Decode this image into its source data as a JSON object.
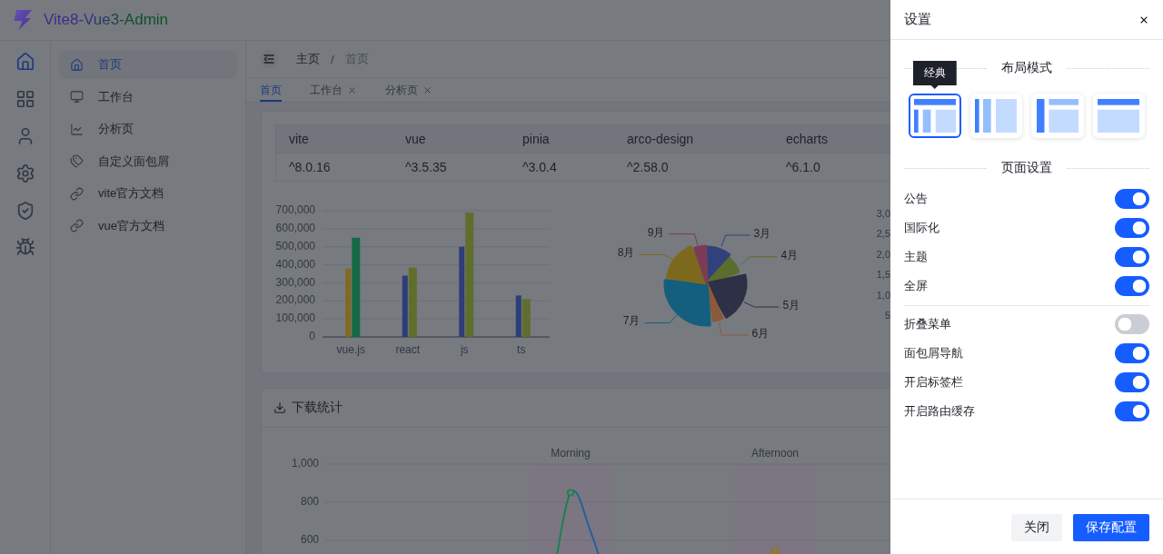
{
  "header": {
    "title": "Vite8-Vue3-Admin"
  },
  "icon_rail": [
    {
      "selected": true
    },
    {
      "selected": false
    },
    {
      "selected": false
    },
    {
      "selected": false
    },
    {
      "selected": false
    },
    {
      "selected": false
    }
  ],
  "menu": [
    {
      "label": "首页",
      "selected": true
    },
    {
      "label": "工作台",
      "selected": false
    },
    {
      "label": "分析页",
      "selected": false
    },
    {
      "label": "自定义面包屑",
      "selected": false
    },
    {
      "label": "vite官方文档",
      "selected": false
    },
    {
      "label": "vue官方文档",
      "selected": false
    }
  ],
  "breadcrumb": {
    "items": [
      "主页",
      "首页"
    ],
    "separator": "/"
  },
  "tabs": [
    {
      "label": "首页",
      "selected": true,
      "closable": false
    },
    {
      "label": "工作台",
      "selected": false,
      "closable": true
    },
    {
      "label": "分析页",
      "selected": false,
      "closable": true
    }
  ],
  "version_table": {
    "columns": [
      "vite",
      "vue",
      "pinia",
      "arco-design",
      "echarts"
    ],
    "rows": [
      [
        "^8.0.16",
        "^3.5.35",
        "^3.0.4",
        "^2.58.0",
        "^6.1.0"
      ]
    ]
  },
  "bar_chart": {
    "chart_data": {
      "type": "bar",
      "grid": true,
      "categories": [
        "vue.js",
        "react",
        "js",
        "ts"
      ],
      "series": [
        {
          "colors": [
            "#83691e",
            "#2e3d78",
            "#2e3d78",
            "#2e3d78"
          ],
          "values": [
            380000,
            340000,
            500000,
            230000
          ]
        },
        {
          "colors": [
            "#146a46",
            "#5f6e2d",
            "#5f6e2d",
            "#5f6e2d"
          ],
          "values": [
            550000,
            385000,
            690000,
            210000
          ]
        }
      ],
      "ylim": [
        0,
        700000
      ],
      "yticks": [
        {
          "value": 0,
          "label": "0"
        },
        {
          "value": 100000,
          "label": "100,000"
        },
        {
          "value": 200000,
          "label": "200,000"
        },
        {
          "value": 300000,
          "label": "300,000"
        },
        {
          "value": 400000,
          "label": "400,000"
        },
        {
          "value": 500000,
          "label": "500,000"
        },
        {
          "value": 600000,
          "label": "600,000"
        },
        {
          "value": 700000,
          "label": "700,000"
        }
      ]
    }
  },
  "rose_chart": {
    "slices": [
      {
        "label": "3月",
        "color": "#32417d"
      },
      {
        "label": "4月",
        "color": "#5a6e2d"
      },
      {
        "label": "5月",
        "color": "#2d3046"
      },
      {
        "label": "6月",
        "color": "#8a5a3a"
      },
      {
        "label": "7月",
        "color": "#145f7d"
      },
      {
        "label": "8月",
        "color": "#7d691e"
      },
      {
        "label": "9月",
        "color": "#7d3c55"
      }
    ]
  },
  "partial_chart": {
    "ytick_labels": [
      "3,0",
      "2,5",
      "2,0",
      "1,5",
      "1,0",
      "5"
    ]
  },
  "download_card": {
    "title": "下载统计",
    "chart": {
      "ytick_labels": [
        "1,000",
        "800",
        "600"
      ],
      "band_labels": [
        "Morning",
        "Afternoon"
      ]
    }
  },
  "settings_drawer": {
    "open": true,
    "title": "设置",
    "layout_title": "布局模式",
    "layouts": [
      {
        "kind": "classic",
        "selected": true,
        "tooltip": "经典"
      },
      {
        "kind": "columns",
        "selected": false
      },
      {
        "kind": "vertical",
        "selected": false
      },
      {
        "kind": "horizontal",
        "selected": false
      }
    ],
    "page_title": "页面设置",
    "switch_groups": [
      [
        {
          "label": "公告",
          "on": true
        },
        {
          "label": "国际化",
          "on": true
        },
        {
          "label": "主题",
          "on": true
        },
        {
          "label": "全屏",
          "on": true
        }
      ],
      [
        {
          "label": "折叠菜单",
          "on": false
        },
        {
          "label": "面包屑导航",
          "on": true
        },
        {
          "label": "开启标签栏",
          "on": true
        },
        {
          "label": "开启路由缓存",
          "on": true
        }
      ]
    ],
    "buttons": [
      {
        "label": "关闭",
        "kind": "secondary"
      },
      {
        "label": "保存配置",
        "kind": "primary"
      }
    ]
  }
}
